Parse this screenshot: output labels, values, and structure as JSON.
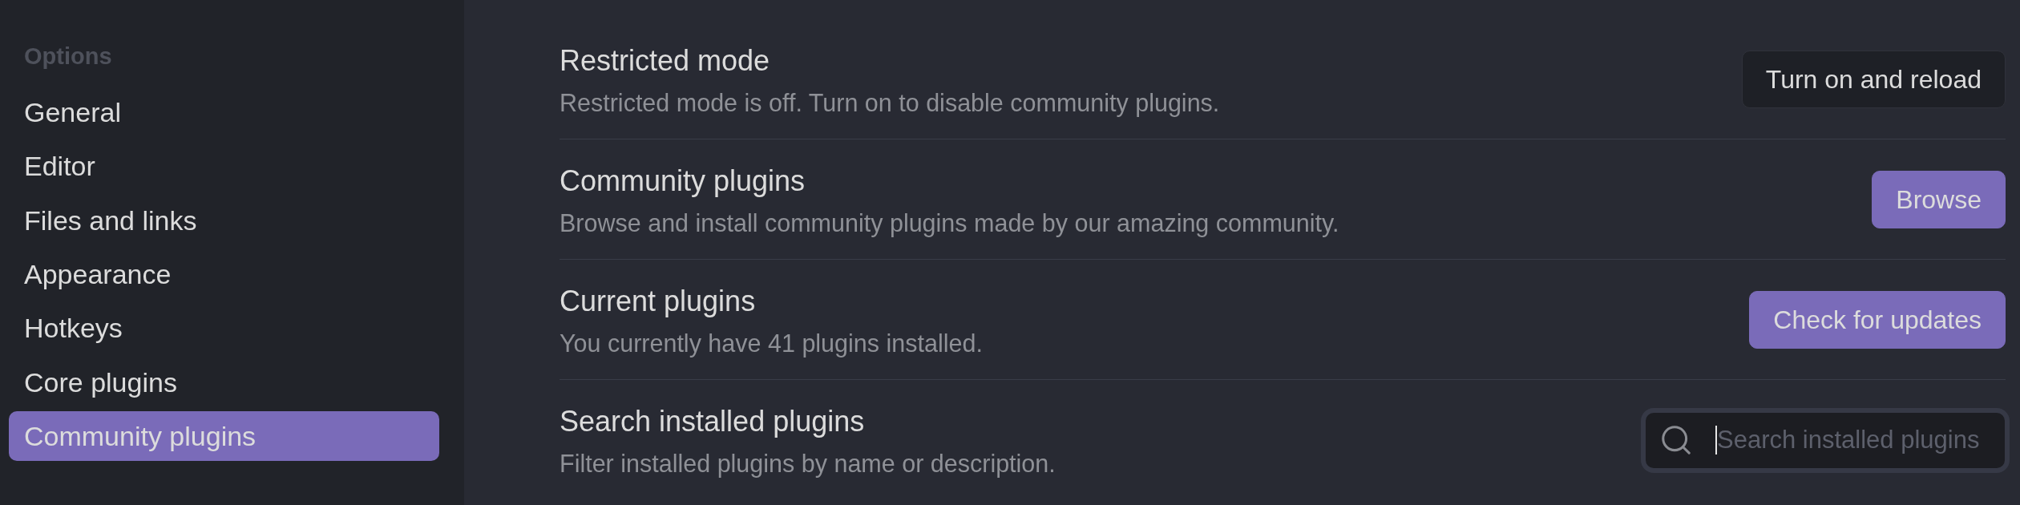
{
  "sidebar": {
    "heading": "Options",
    "items": [
      {
        "label": "General",
        "selected": false
      },
      {
        "label": "Editor",
        "selected": false
      },
      {
        "label": "Files and links",
        "selected": false
      },
      {
        "label": "Appearance",
        "selected": false
      },
      {
        "label": "Hotkeys",
        "selected": false
      },
      {
        "label": "Core plugins",
        "selected": false
      },
      {
        "label": "Community plugins",
        "selected": true
      }
    ]
  },
  "settings": [
    {
      "kind": "button",
      "title": "Restricted mode",
      "description": "Restricted mode is off. Turn on to disable community plugins.",
      "button": {
        "label": "Turn on and reload",
        "primary": false
      }
    },
    {
      "kind": "button",
      "title": "Community plugins",
      "description": "Browse and install community plugins made by our amazing community.",
      "button": {
        "label": "Browse",
        "primary": true
      }
    },
    {
      "kind": "button",
      "title": "Current plugins",
      "description": "You currently have 41 plugins installed.",
      "button": {
        "label": "Check for updates",
        "primary": true
      }
    },
    {
      "kind": "search",
      "title": "Search installed plugins",
      "description": "Filter installed plugins by name or description.",
      "search": {
        "placeholder": "Search installed plugins",
        "focused": true
      }
    }
  ]
}
